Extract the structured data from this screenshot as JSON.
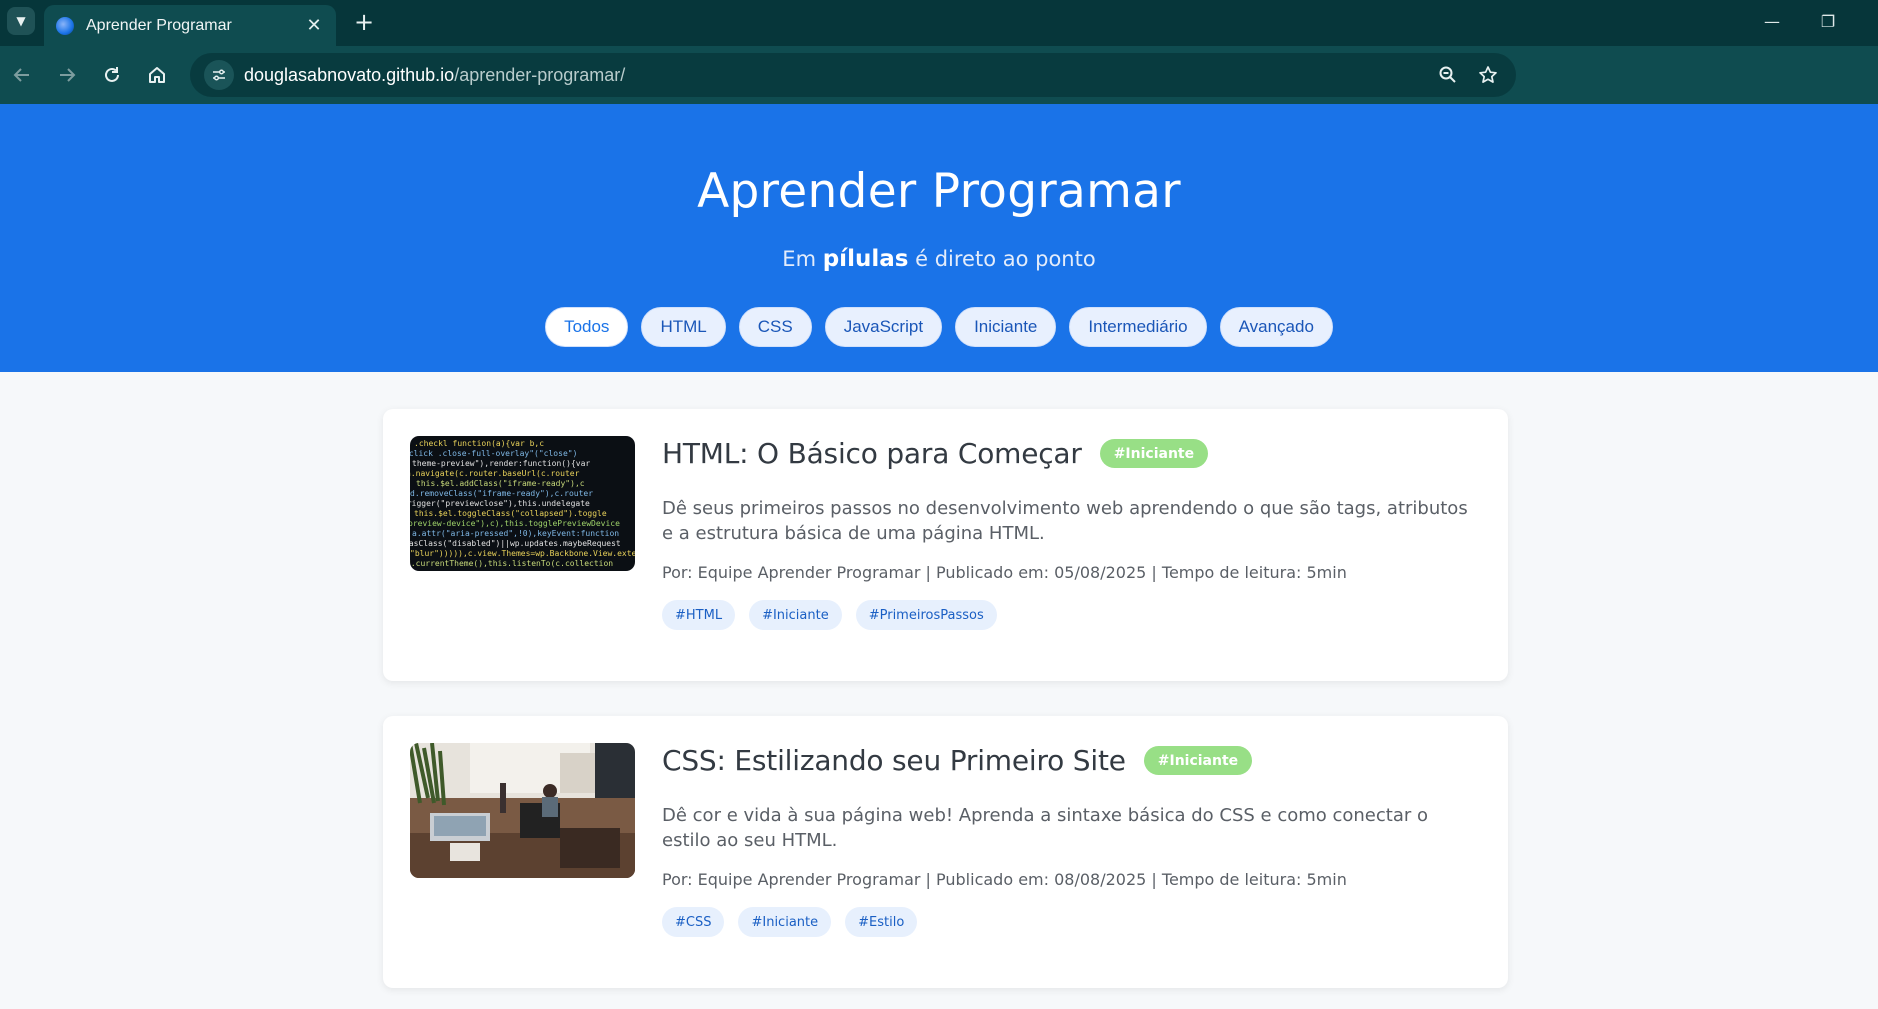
{
  "browser": {
    "tab_title": "Aprender Programar",
    "new_tab": "+",
    "url_host": "douglasabnovato.github.io",
    "url_path": "/aprender-programar/",
    "window_controls": {
      "minimize": "—",
      "restore": "❐"
    }
  },
  "page": {
    "title": "Aprender Programar",
    "subtitle_before": "Em",
    "subtitle_bold": "pílulas",
    "subtitle_after": "é direto ao ponto",
    "filters": [
      "Todos",
      "HTML",
      "CSS",
      "JavaScript",
      "Iniciante",
      "Intermediário",
      "Avançado"
    ],
    "active_filter": "Todos"
  },
  "articles": [
    {
      "title": "HTML: O Básico para Começar",
      "level": "#Iniciante",
      "description": "Dê seus primeiros passos no desenvolvimento web aprendendo o que são tags, atributos e a estrutura básica de uma página HTML.",
      "meta": "Por: Equipe Aprender Programar | Publicado em: 05/08/2025 | Tempo de leitura: 5min",
      "tags": [
        "#HTML",
        "#Iniciante",
        "#PrimeirosPassos"
      ]
    },
    {
      "title": "CSS: Estilizando seu Primeiro Site",
      "level": "#Iniciante",
      "description": "Dê cor e vida à sua página web! Aprenda a sintaxe básica do CSS e como conectar o estilo ao seu HTML.",
      "meta": "Por: Equipe Aprender Programar | Publicado em: 08/08/2025 | Tempo de leitura: 5min",
      "tags": [
        "#CSS",
        "#Iniciante",
        "#Estilo"
      ]
    }
  ],
  "colors": {
    "hero": "#1a73e8",
    "level_badge": "#98df86",
    "tag_bg": "#e7f0fd",
    "chrome_dark": "#06363a",
    "chrome_toolbar": "#0f4c50"
  }
}
